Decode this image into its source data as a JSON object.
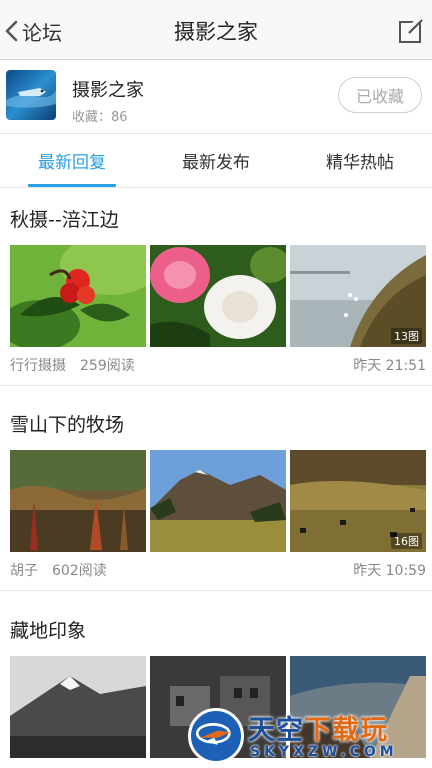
{
  "nav": {
    "back_label": "论坛",
    "title": "摄影之家"
  },
  "forum": {
    "name": "摄影之家",
    "fav_count_text": "收藏：86",
    "fav_button_label": "已收藏"
  },
  "tabs": [
    {
      "label": "最新回复",
      "active": true
    },
    {
      "label": "最新发布",
      "active": false
    },
    {
      "label": "精华热帖",
      "active": false
    }
  ],
  "posts": [
    {
      "title": "秋摄--涪江边",
      "author": "行行摄摄",
      "reads": "259阅读",
      "time": "昨天 21:51",
      "image_count": "13图"
    },
    {
      "title": "雪山下的牧场",
      "author": "胡子",
      "reads": "602阅读",
      "time": "昨天 10:59",
      "image_count": "16图"
    },
    {
      "title": "藏地印象"
    }
  ],
  "watermark": {
    "cn_part1": "天空",
    "cn_part2": "下载玩",
    "en": "SKYXZW.COM"
  },
  "colors": {
    "accent": "#2a9ee6",
    "watermark_blue": "#1c4f9c",
    "watermark_orange": "#e36a15"
  }
}
